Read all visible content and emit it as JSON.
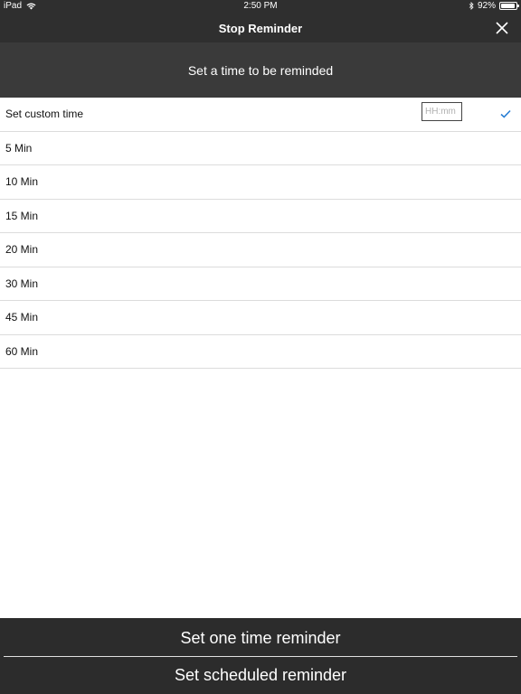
{
  "status_bar": {
    "device": "iPad",
    "time": "2:50 PM",
    "battery": "92%",
    "battery_level": 0.92
  },
  "header": {
    "title": "Stop Reminder",
    "close_icon": "close-icon"
  },
  "subheader": {
    "text": "Set a time to be reminded"
  },
  "options": [
    {
      "label": "Set custom time",
      "selected": true,
      "input_placeholder": "HH:mm"
    },
    {
      "label": "5 Min"
    },
    {
      "label": "10 Min"
    },
    {
      "label": "15 Min"
    },
    {
      "label": "20 Min"
    },
    {
      "label": "30 Min"
    },
    {
      "label": "45 Min"
    },
    {
      "label": "60 Min"
    }
  ],
  "footer": {
    "one_time_label": "Set one time reminder",
    "scheduled_label": "Set scheduled reminder"
  },
  "colors": {
    "header_bg": "#2f2f2f",
    "subheader_bg": "#3a3a3a",
    "footer_bg": "#2c2c2c",
    "checkmark": "#2a7fd4"
  }
}
